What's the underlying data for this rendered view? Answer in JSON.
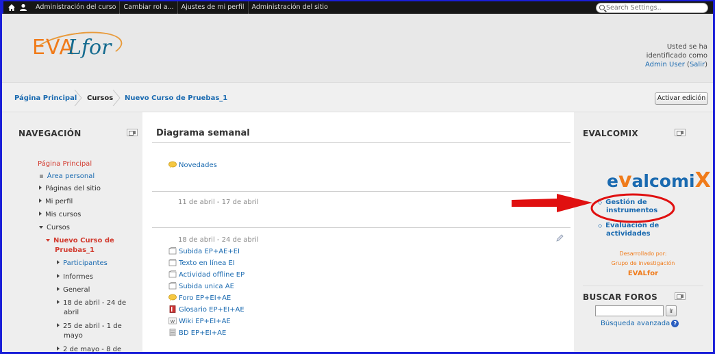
{
  "topbar": {
    "menu": [
      "Administración del curso",
      "Cambiar rol a...",
      "Ajustes de mi perfil",
      "Administración del sitio"
    ],
    "search_placeholder": "Search Settings.."
  },
  "header": {
    "logo_text_a": "EVA",
    "logo_text_b": "Lfor",
    "user_line1": "Usted se ha",
    "user_line2": "identificado como",
    "user_name": "Admin User",
    "logout_open": " (",
    "logout": "Salir",
    "logout_close": ")"
  },
  "breadcrumb": {
    "items": [
      "Página Principal",
      "Cursos",
      "Nuevo Curso de Pruebas_1"
    ],
    "edit_button": "Activar edición"
  },
  "navigation": {
    "title": "NAVEGACIÓN",
    "home": "Página Principal",
    "personal": "Área personal",
    "site_pages": "Páginas del sitio",
    "profile": "Mi perfil",
    "my_courses": "Mis cursos",
    "courses": "Cursos",
    "current_course_1": "Nuevo Curso de",
    "current_course_2": "Pruebas_1",
    "participants": "Participantes",
    "reports": "Informes",
    "general": "General",
    "week1_a": "18 de abril - 24 de",
    "week1_b": "abril",
    "week2_a": "25 de abril - 1 de",
    "week2_b": "mayo",
    "week3": "2 de mayo - 8 de"
  },
  "center": {
    "title": "Diagrama semanal",
    "news": "Novedades",
    "week_a": "11 de abril - 17 de abril",
    "week_b": "18 de abril - 24 de abril",
    "activities": [
      {
        "label": "Subida EP+AE+EI",
        "icon": "upload-icon"
      },
      {
        "label": "Texto en línea EI",
        "icon": "upload-icon"
      },
      {
        "label": "Actividad offline EP",
        "icon": "upload-icon"
      },
      {
        "label": "Subida unica AE",
        "icon": "upload-icon"
      },
      {
        "label": "Foro EP+EI+AE",
        "icon": "forum-icon"
      },
      {
        "label": "Glosario EP+EI+AE",
        "icon": "glossary-icon"
      },
      {
        "label": "Wiki EP+EI+AE",
        "icon": "wiki-icon"
      },
      {
        "label": "BD EP+EI+AE",
        "icon": "database-icon"
      }
    ]
  },
  "evalcomix": {
    "title": "EVALCOMIX",
    "logo_a": "e",
    "logo_b": "alcomi",
    "logo_c": "X",
    "link1_a": "Gestión de",
    "link1_b": "instrumentos",
    "link2_a": "Evaluación de",
    "link2_b": "actividades",
    "dev1": "Desarrollado por:",
    "dev2": "Grupo de investigación",
    "dev3": "EVALfor"
  },
  "forums": {
    "title": "BUSCAR FOROS",
    "button": "Ir",
    "advanced": "Búsqueda avanzada"
  },
  "colors": {
    "accent": "#1a6ab0",
    "highlight_red": "#e01010",
    "brand_orange": "#f07b1a"
  }
}
